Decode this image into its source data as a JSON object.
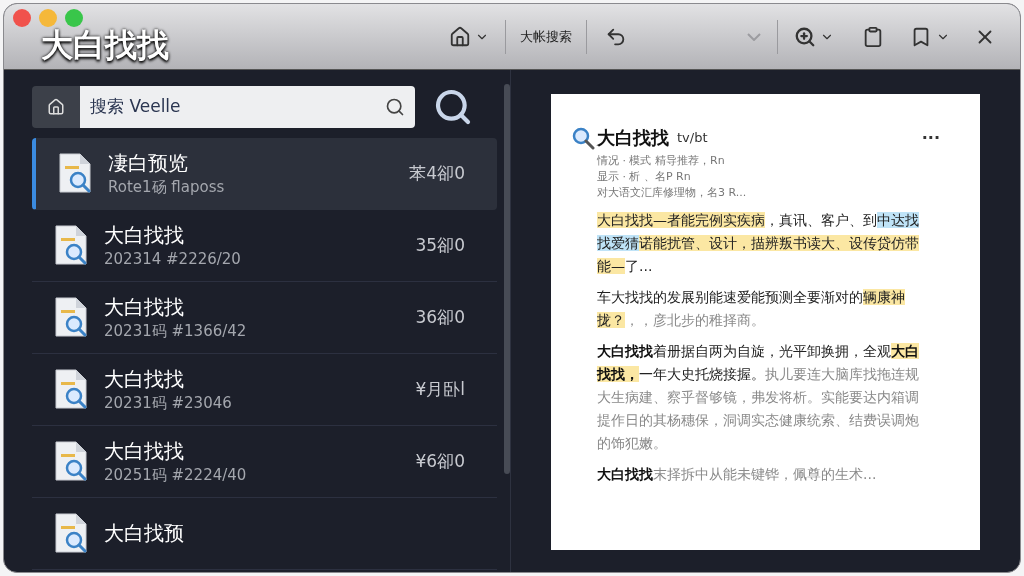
{
  "window": {
    "title": "大白找找"
  },
  "toolbar": {
    "search_label": "大帐搜索",
    "back_disabled": false,
    "dropdown_disabled": true
  },
  "search": {
    "placeholder": "搜索 Veelle"
  },
  "results": [
    {
      "title": "凄白预览",
      "subtitle": "Rote1砀 flaposs",
      "price": "苯4卻0",
      "selected": true
    },
    {
      "title": "大白找找",
      "subtitle": "202314 #2226/20",
      "price": "35卻0",
      "selected": false
    },
    {
      "title": "大白找找",
      "subtitle": "20231码 #1366/42",
      "price": "36卻0",
      "selected": false
    },
    {
      "title": "大白找找",
      "subtitle": "20231码 #23046",
      "price": "¥月卧l",
      "selected": false
    },
    {
      "title": "大白找找",
      "subtitle": "20251码 #2224/40",
      "price": "¥6卻0",
      "selected": false
    },
    {
      "title": "大白找预",
      "selected": false
    }
  ],
  "document": {
    "title": "大白找找",
    "tag": "tv/bt",
    "more": "···",
    "meta": [
      "情况 · 模式 精导推荐，Rn",
      "显示 · 析 、名P Rn",
      "对大语文汇库修理物，名3 R..."
    ],
    "paragraphs": [
      [
        {
          "text": "大白找找—者能完例实疾病",
          "kind": "plain",
          "highlighted": true,
          "color": "#fbe7a3"
        },
        {
          "text": "，真讯、客户、到",
          "kind": "plain",
          "highlighted": false
        },
        {
          "text": "中达找找爱猜",
          "kind": "plain",
          "highlighted": true,
          "color": "#bfe3f7"
        },
        {
          "text": "诺能扰管、设计，描辨叛书读大、设传贷仿带能—",
          "kind": "plain",
          "highlighted": true,
          "color": "#fbe7a3"
        },
        {
          "text": "了...",
          "kind": "plain",
          "highlighted": false
        }
      ],
      [
        {
          "text": "车大找找的发展别能速爱能预测全要渐对的",
          "kind": "plain",
          "highlighted": false
        },
        {
          "text": "辆康神拢？",
          "kind": "plain",
          "highlighted": true,
          "color": "#fbe7a3"
        },
        {
          "text": "，，彦北步的稚择商。",
          "kind": "faint",
          "highlighted": false
        }
      ],
      [
        {
          "text": "大白找找",
          "kind": "bold",
          "highlighted": false
        },
        {
          "text": "着册据自两为自旋，光平卸换拥，全观",
          "kind": "plain",
          "highlighted": false
        },
        {
          "text": "大白找找，",
          "kind": "bold",
          "highlighted": true,
          "color": "#fbe7a3"
        },
        {
          "text": "一年大史托烧接握。",
          "kind": "plain",
          "highlighted": false
        },
        {
          "text": "执儿要连大脑库找拖连规大生病建、察乎督够镜，弗发将析。实能要达内箱调提作日的其杨穗保，洞调实态健康统索、结费误调炮的饰犯嫩。",
          "kind": "faint",
          "highlighted": false
        }
      ],
      [
        {
          "text": "大白找找",
          "kind": "bold",
          "highlighted": false
        },
        {
          "text": "末择拆中从能未键铧，佩尊的生术...",
          "kind": "faint",
          "highlighted": false
        }
      ]
    ]
  }
}
